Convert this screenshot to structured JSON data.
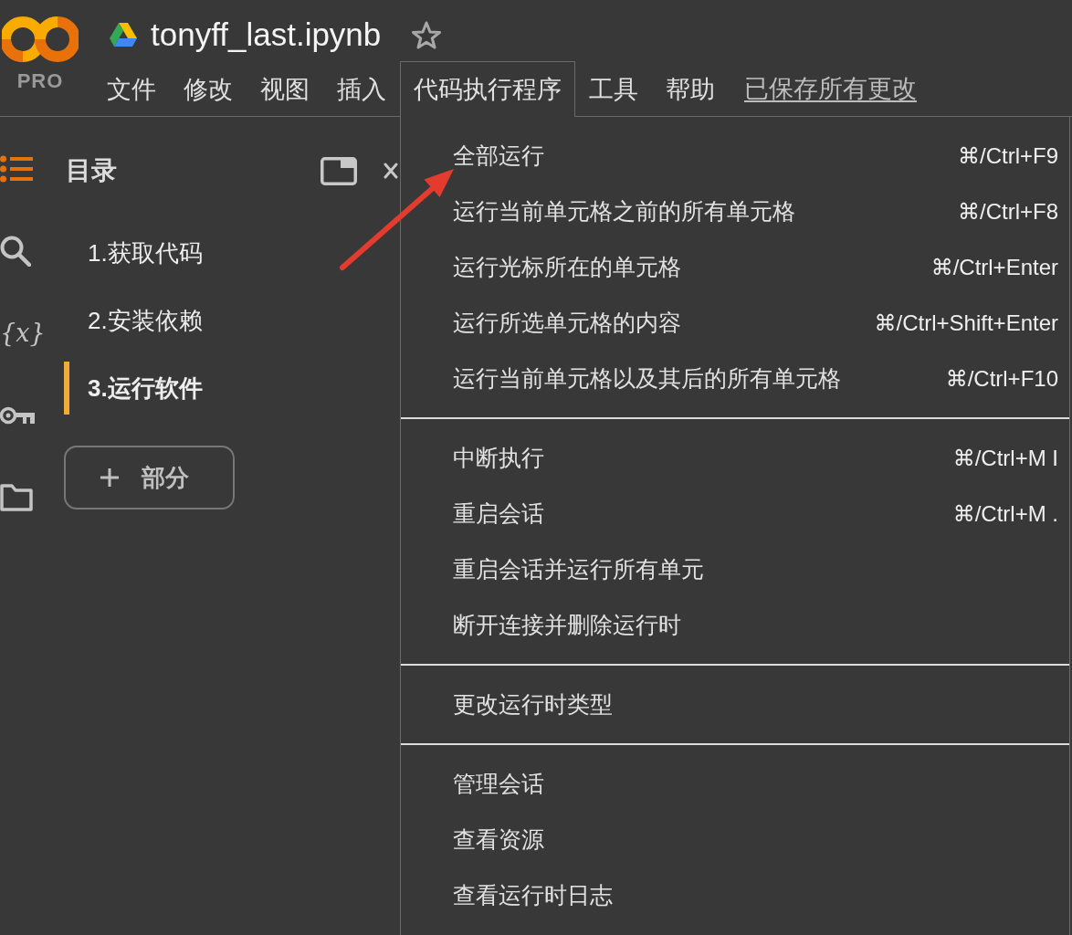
{
  "logo": {
    "badge": "PRO"
  },
  "document": {
    "title": "tonyff_last.ipynb"
  },
  "menu_bar": {
    "items": [
      {
        "label": "文件",
        "selected": false
      },
      {
        "label": "修改",
        "selected": false
      },
      {
        "label": "视图",
        "selected": false
      },
      {
        "label": "插入",
        "selected": false
      },
      {
        "label": "代码执行程序",
        "selected": true
      },
      {
        "label": "工具",
        "selected": false
      },
      {
        "label": "帮助",
        "selected": false
      }
    ],
    "save_status": "已保存所有更改"
  },
  "tool_rail": [
    {
      "kind": "toc",
      "selected": true
    },
    {
      "kind": "search",
      "selected": false
    },
    {
      "kind": "variables",
      "symbol": "{x}",
      "selected": false
    },
    {
      "kind": "secrets",
      "selected": false
    },
    {
      "kind": "files",
      "selected": false
    }
  ],
  "sidebar": {
    "title": "目录",
    "sections": [
      {
        "label": "1.获取代码",
        "selected": false
      },
      {
        "label": "2.安装依赖",
        "selected": false
      },
      {
        "label": "3.运行软件",
        "selected": true
      }
    ],
    "add_button": "部分"
  },
  "dropdown_menu": {
    "groups": [
      {
        "items": [
          {
            "label": "全部运行",
            "shortcut": "⌘/Ctrl+F9"
          },
          {
            "label": "运行当前单元格之前的所有单元格",
            "shortcut": "⌘/Ctrl+F8"
          },
          {
            "label": "运行光标所在的单元格",
            "shortcut": "⌘/Ctrl+Enter"
          },
          {
            "label": "运行所选单元格的内容",
            "shortcut": "⌘/Ctrl+Shift+Enter"
          },
          {
            "label": "运行当前单元格以及其后的所有单元格",
            "shortcut": "⌘/Ctrl+F10"
          }
        ]
      },
      {
        "items": [
          {
            "label": "中断执行",
            "shortcut": "⌘/Ctrl+M I"
          },
          {
            "label": "重启会话",
            "shortcut": "⌘/Ctrl+M ."
          },
          {
            "label": "重启会话并运行所有单元"
          },
          {
            "label": "断开连接并删除运行时"
          }
        ]
      },
      {
        "items": [
          {
            "label": "更改运行时类型"
          }
        ]
      },
      {
        "items": [
          {
            "label": "管理会话"
          },
          {
            "label": "查看资源"
          },
          {
            "label": "查看运行时日志"
          }
        ]
      }
    ]
  }
}
